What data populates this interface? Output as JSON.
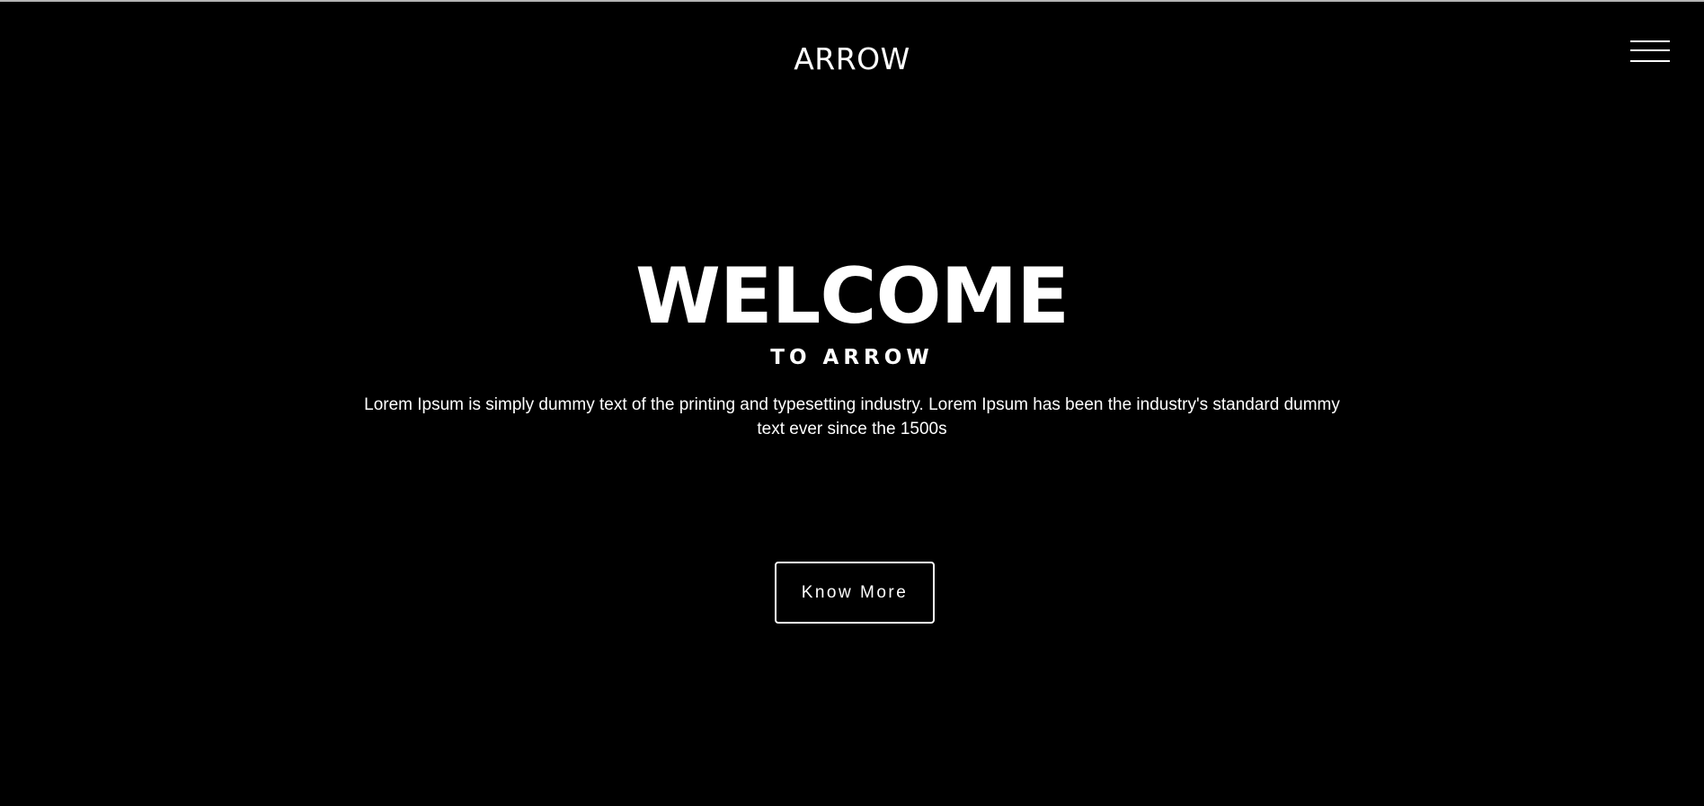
{
  "header": {
    "logo": "ARROW",
    "menu_icon": "hamburger-menu-icon"
  },
  "hero": {
    "title": "WELCOME",
    "subtitle": "TO ARROW",
    "text": "Lorem Ipsum is simply dummy text of the printing and typesetting industry. Lorem Ipsum has been the industry's standard dummy text ever since the 1500s",
    "button_label": "Know More"
  },
  "colors": {
    "background": "#000000",
    "foreground": "#ffffff"
  }
}
